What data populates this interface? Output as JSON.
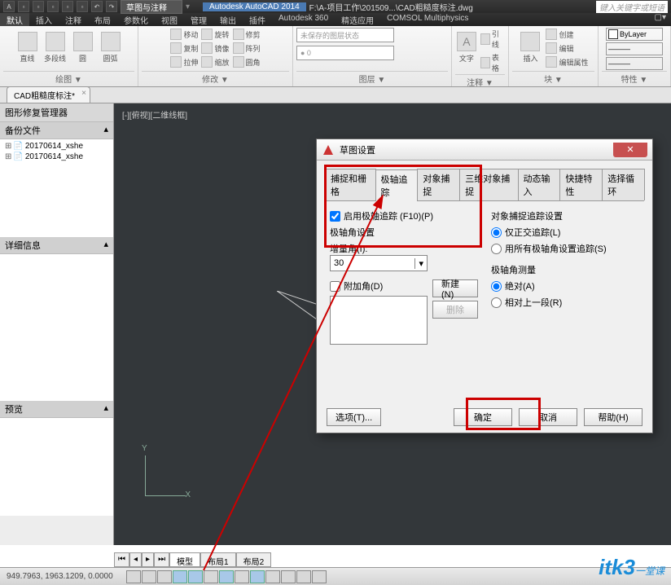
{
  "titlebar": {
    "doc_dropdown": "草图与注释",
    "app": "Autodesk AutoCAD 2014",
    "path": "F:\\A-项目工作\\201509...\\CAD粗糙度标注.dwg",
    "search_placeholder": "键入关键字或短语"
  },
  "ribbon_tabs": [
    "默认",
    "插入",
    "注释",
    "布局",
    "参数化",
    "视图",
    "管理",
    "输出",
    "插件",
    "Autodesk 360",
    "精选应用",
    "COMSOL Multiphysics"
  ],
  "panels": {
    "draw": {
      "title": "绘图 ▼",
      "items": [
        "直线",
        "多段线",
        "圆",
        "圆弧"
      ]
    },
    "modify": {
      "title": "修改 ▼",
      "items": [
        "移动",
        "复制",
        "拉伸",
        "旋转",
        "镜像",
        "缩放",
        "修剪",
        "阵列",
        "圆角"
      ]
    },
    "layer": {
      "title": "图层 ▼",
      "placeholder": "未保存的图层状态"
    },
    "annot": {
      "title": "注释 ▼",
      "items": [
        "文字",
        "引线",
        "表格"
      ]
    },
    "block": {
      "title": "块 ▼",
      "items": [
        "插入",
        "创建",
        "编辑",
        "编辑属性"
      ]
    },
    "props": {
      "title": "特性 ▼",
      "bylayer": "ByLayer"
    }
  },
  "doc_tab": "CAD粗糙度标注*",
  "sidebar": {
    "title": "图形修复管理器",
    "sections": {
      "backup": {
        "title": "备份文件",
        "items": [
          "20170614_xshe",
          "20170614_xshe"
        ]
      },
      "detail": {
        "title": "详细信息"
      },
      "preview": {
        "title": "预览"
      }
    }
  },
  "viewport_label": "[-][俯视][二维线框]",
  "ucs": {
    "x": "X",
    "y": "Y"
  },
  "model_tabs": {
    "model": "模型",
    "layout1": "布局1",
    "layout2": "布局2"
  },
  "status": {
    "coords": "949.7963, 1963.1209, 0.0000"
  },
  "dialog": {
    "title": "草图设置",
    "tabs": [
      "捕捉和栅格",
      "极轴追踪",
      "对象捕捉",
      "三维对象捕捉",
      "动态输入",
      "快捷特性",
      "选择循环"
    ],
    "active_tab": 1,
    "polar": {
      "enable": "启用极轴追踪 (F10)(P)",
      "angle_group": "极轴角设置",
      "increment_label": "增量角(I):",
      "increment_value": "30",
      "additional": "附加角(D)",
      "new_btn": "新建(N)",
      "del_btn": "删除"
    },
    "snap_track": {
      "group": "对象捕捉追踪设置",
      "ortho": "仅正交追踪(L)",
      "all_polar": "用所有极轴角设置追踪(S)"
    },
    "measure": {
      "group": "极轴角测量",
      "absolute": "绝对(A)",
      "relative": "相对上一段(R)"
    },
    "footer": {
      "options": "选项(T)...",
      "ok": "确定",
      "cancel": "取消",
      "help": "帮助(H)"
    }
  },
  "watermark": {
    "main": "itk3",
    "sub": "一堂课"
  }
}
